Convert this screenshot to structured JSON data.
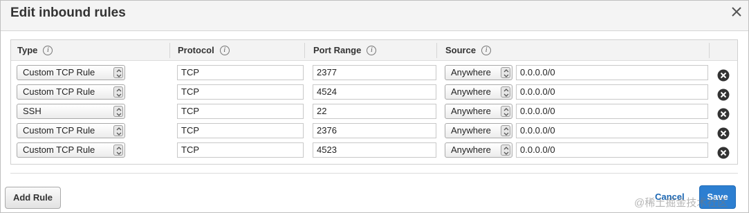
{
  "dialog": {
    "title": "Edit inbound rules",
    "close_icon": "close-icon"
  },
  "table": {
    "headers": [
      "Type",
      "Protocol",
      "Port Range",
      "Source"
    ],
    "info_glyph": "i",
    "rows": [
      {
        "type": "Custom TCP Rule",
        "protocol": "TCP",
        "port_range": "2377",
        "source": "Anywhere",
        "cidr": "0.0.0.0/0"
      },
      {
        "type": "Custom TCP Rule",
        "protocol": "TCP",
        "port_range": "4524",
        "source": "Anywhere",
        "cidr": "0.0.0.0/0"
      },
      {
        "type": "SSH",
        "protocol": "TCP",
        "port_range": "22",
        "source": "Anywhere",
        "cidr": "0.0.0.0/0"
      },
      {
        "type": "Custom TCP Rule",
        "protocol": "TCP",
        "port_range": "2376",
        "source": "Anywhere",
        "cidr": "0.0.0.0/0"
      },
      {
        "type": "Custom TCP Rule",
        "protocol": "TCP",
        "port_range": "4523",
        "source": "Anywhere",
        "cidr": "0.0.0.0/0"
      }
    ]
  },
  "footer": {
    "add_rule_label": "Add Rule",
    "cancel_label": "Cancel",
    "save_label": "Save",
    "watermark": "@稀土掘金技术社区"
  },
  "colors": {
    "primary_button": "#2d7fd1",
    "link": "#1a66b3",
    "delete_icon": "#333333"
  }
}
